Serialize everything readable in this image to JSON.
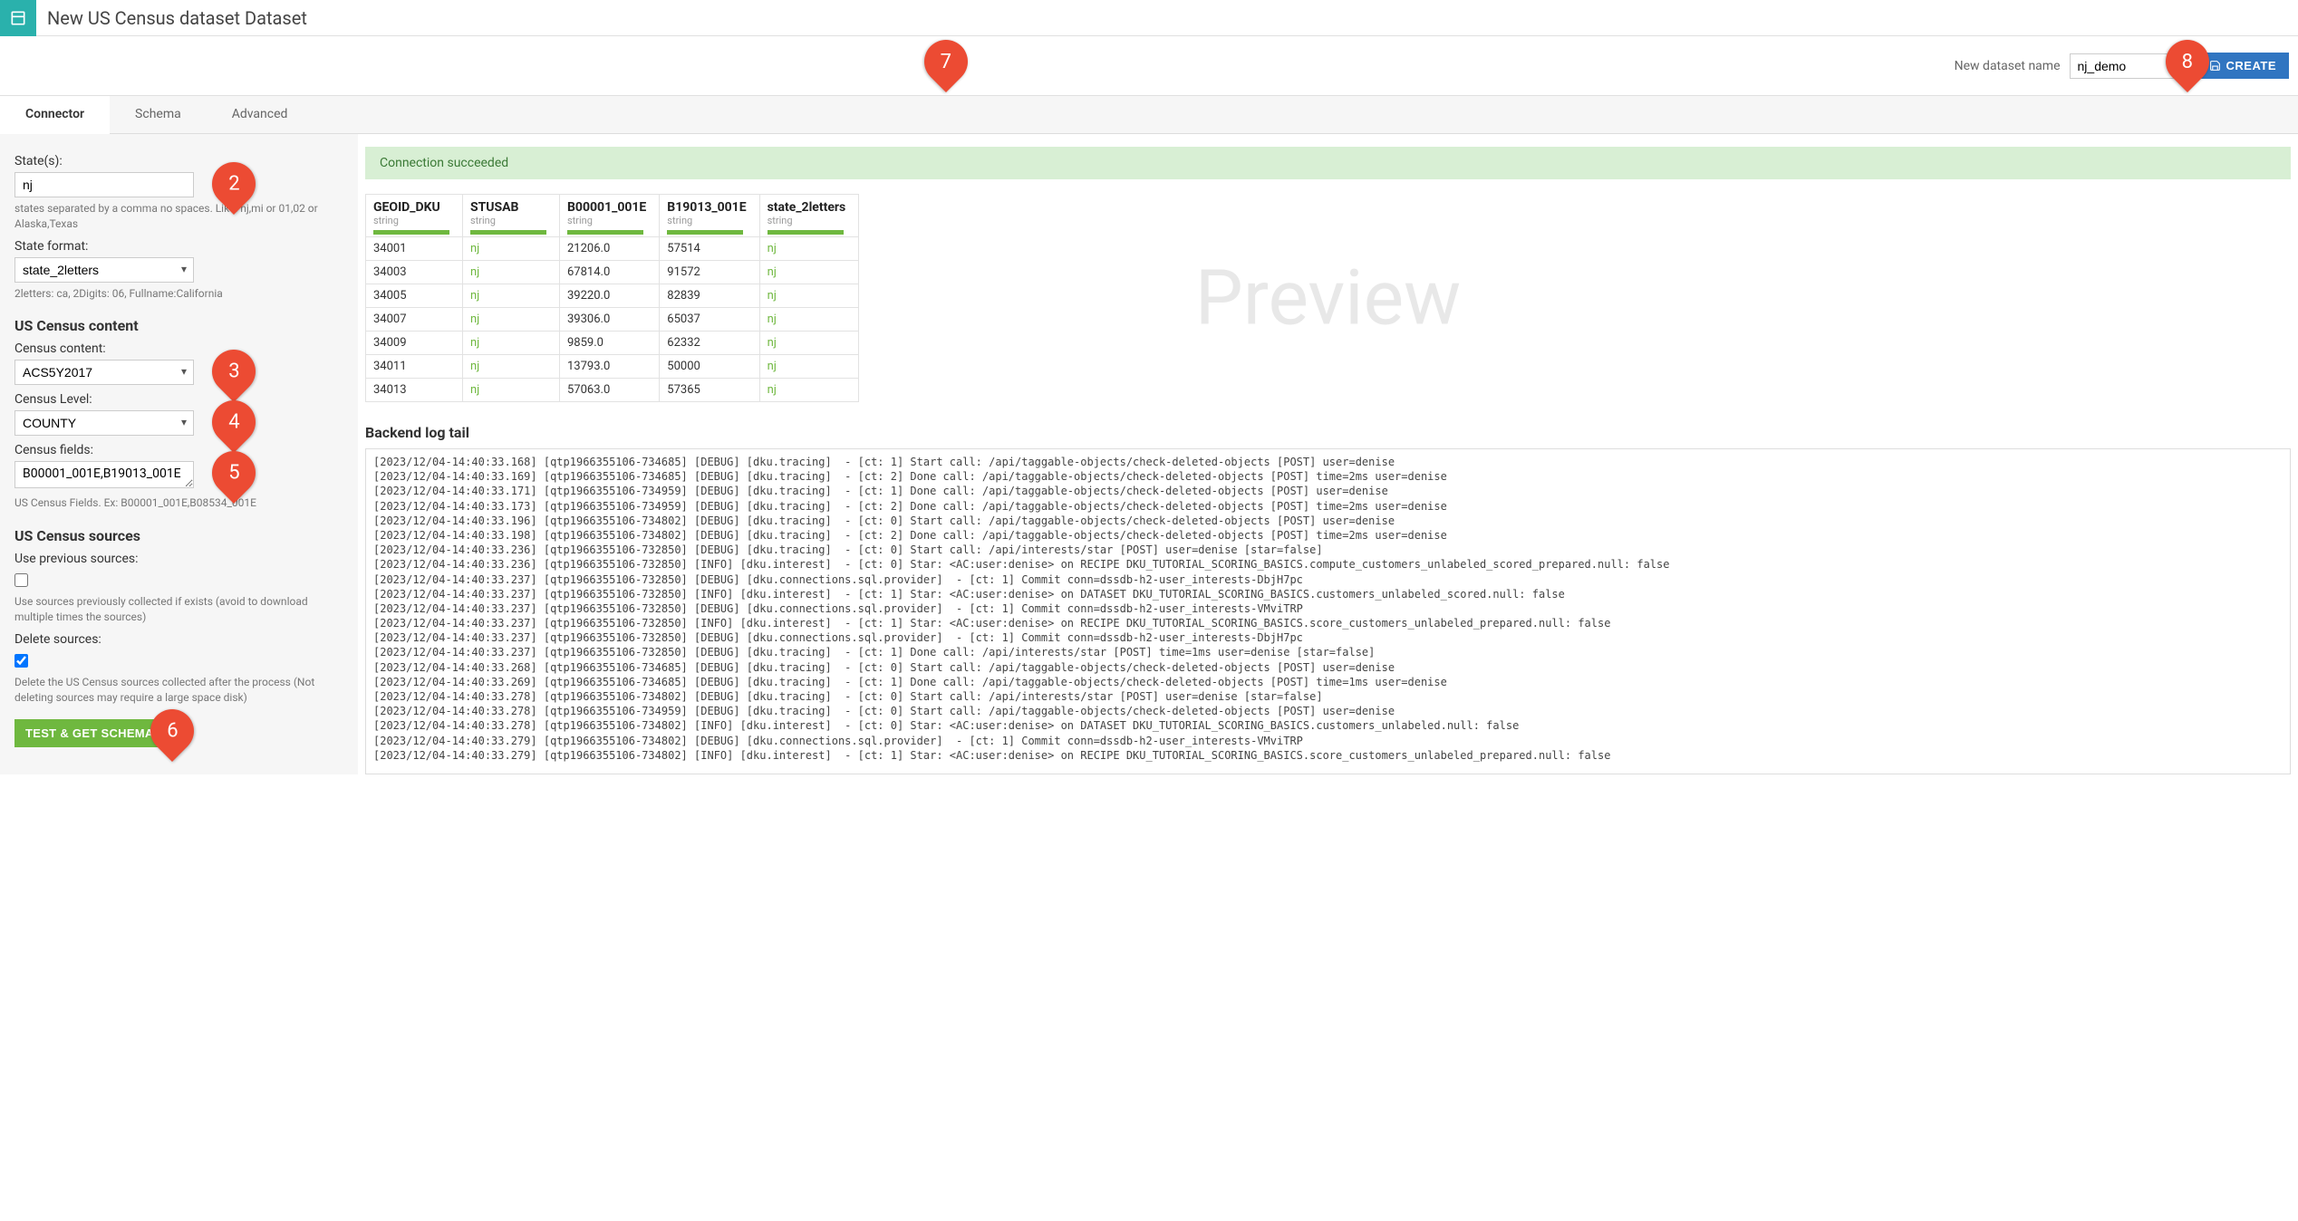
{
  "header": {
    "title": "New US Census dataset Dataset"
  },
  "create": {
    "label": "New dataset name",
    "value": "nj_demo",
    "button": "CREATE"
  },
  "tabs": {
    "connector": "Connector",
    "schema": "Schema",
    "advanced": "Advanced"
  },
  "sidebar": {
    "states_label": "State(s):",
    "states_value": "nj",
    "states_help": "states separated by a comma no spaces. Like: nj,mi or 01,02 or Alaska,Texas",
    "state_format_label": "State format:",
    "state_format_value": "state_2letters",
    "state_format_help": "2letters: ca, 2Digits: 06, Fullname:California",
    "census_content_heading": "US Census content",
    "census_content_label": "Census content:",
    "census_content_value": "ACS5Y2017",
    "census_level_label": "Census Level:",
    "census_level_value": "COUNTY",
    "census_fields_label": "Census fields:",
    "census_fields_value": "B00001_001E,B19013_001E",
    "census_fields_help": "US Census Fields. Ex: B00001_001E,B08534_001E",
    "census_sources_heading": "US Census sources",
    "use_prev_label": "Use previous sources:",
    "use_prev_help": "Use sources previously collected if exists (avoid to download multiple times the sources)",
    "delete_label": "Delete sources:",
    "delete_help": "Delete the US Census sources collected after the process (Not deleting sources may require a large space disk)",
    "test_button": "TEST & GET SCHEMA"
  },
  "content": {
    "success": "Connection succeeded",
    "watermark": "Preview",
    "columns": [
      {
        "name": "GEOID_DKU",
        "type": "string"
      },
      {
        "name": "STUSAB",
        "type": "string"
      },
      {
        "name": "B00001_001E",
        "type": "string"
      },
      {
        "name": "B19013_001E",
        "type": "string"
      },
      {
        "name": "state_2letters",
        "type": "string"
      }
    ],
    "rows": [
      [
        "34001",
        "nj",
        "21206.0",
        "57514",
        "nj"
      ],
      [
        "34003",
        "nj",
        "67814.0",
        "91572",
        "nj"
      ],
      [
        "34005",
        "nj",
        "39220.0",
        "82839",
        "nj"
      ],
      [
        "34007",
        "nj",
        "39306.0",
        "65037",
        "nj"
      ],
      [
        "34009",
        "nj",
        "9859.0",
        "62332",
        "nj"
      ],
      [
        "34011",
        "nj",
        "13793.0",
        "50000",
        "nj"
      ],
      [
        "34013",
        "nj",
        "57063.0",
        "57365",
        "nj"
      ]
    ],
    "log_heading": "Backend log tail",
    "log_lines": [
      "[2023/12/04-14:40:33.168] [qtp1966355106-734685] [DEBUG] [dku.tracing]  - [ct: 1] Start call: /api/taggable-objects/check-deleted-objects [POST] user=denise",
      "[2023/12/04-14:40:33.169] [qtp1966355106-734685] [DEBUG] [dku.tracing]  - [ct: 2] Done call: /api/taggable-objects/check-deleted-objects [POST] time=2ms user=denise",
      "[2023/12/04-14:40:33.171] [qtp1966355106-734959] [DEBUG] [dku.tracing]  - [ct: 1] Done call: /api/taggable-objects/check-deleted-objects [POST] user=denise",
      "[2023/12/04-14:40:33.173] [qtp1966355106-734959] [DEBUG] [dku.tracing]  - [ct: 2] Done call: /api/taggable-objects/check-deleted-objects [POST] time=2ms user=denise",
      "[2023/12/04-14:40:33.196] [qtp1966355106-734802] [DEBUG] [dku.tracing]  - [ct: 0] Start call: /api/taggable-objects/check-deleted-objects [POST] user=denise",
      "[2023/12/04-14:40:33.198] [qtp1966355106-734802] [DEBUG] [dku.tracing]  - [ct: 2] Done call: /api/taggable-objects/check-deleted-objects [POST] time=2ms user=denise",
      "[2023/12/04-14:40:33.236] [qtp1966355106-732850] [DEBUG] [dku.tracing]  - [ct: 0] Start call: /api/interests/star [POST] user=denise [star=false]",
      "[2023/12/04-14:40:33.236] [qtp1966355106-732850] [INFO] [dku.interest]  - [ct: 0] Star: <AC:user:denise> on RECIPE DKU_TUTORIAL_SCORING_BASICS.compute_customers_unlabeled_scored_prepared.null: false",
      "[2023/12/04-14:40:33.237] [qtp1966355106-732850] [DEBUG] [dku.connections.sql.provider]  - [ct: 1] Commit conn=dssdb-h2-user_interests-DbjH7pc",
      "[2023/12/04-14:40:33.237] [qtp1966355106-732850] [INFO] [dku.interest]  - [ct: 1] Star: <AC:user:denise> on DATASET DKU_TUTORIAL_SCORING_BASICS.customers_unlabeled_scored.null: false",
      "[2023/12/04-14:40:33.237] [qtp1966355106-732850] [DEBUG] [dku.connections.sql.provider]  - [ct: 1] Commit conn=dssdb-h2-user_interests-VMviTRP",
      "[2023/12/04-14:40:33.237] [qtp1966355106-732850] [INFO] [dku.interest]  - [ct: 1] Star: <AC:user:denise> on RECIPE DKU_TUTORIAL_SCORING_BASICS.score_customers_unlabeled_prepared.null: false",
      "[2023/12/04-14:40:33.237] [qtp1966355106-732850] [DEBUG] [dku.connections.sql.provider]  - [ct: 1] Commit conn=dssdb-h2-user_interests-DbjH7pc",
      "[2023/12/04-14:40:33.237] [qtp1966355106-732850] [DEBUG] [dku.tracing]  - [ct: 1] Done call: /api/interests/star [POST] time=1ms user=denise [star=false]",
      "[2023/12/04-14:40:33.268] [qtp1966355106-734685] [DEBUG] [dku.tracing]  - [ct: 0] Start call: /api/taggable-objects/check-deleted-objects [POST] user=denise",
      "[2023/12/04-14:40:33.269] [qtp1966355106-734685] [DEBUG] [dku.tracing]  - [ct: 1] Done call: /api/taggable-objects/check-deleted-objects [POST] time=1ms user=denise",
      "[2023/12/04-14:40:33.278] [qtp1966355106-734802] [DEBUG] [dku.tracing]  - [ct: 0] Start call: /api/interests/star [POST] user=denise [star=false]",
      "[2023/12/04-14:40:33.278] [qtp1966355106-734959] [DEBUG] [dku.tracing]  - [ct: 0] Start call: /api/taggable-objects/check-deleted-objects [POST] user=denise",
      "[2023/12/04-14:40:33.278] [qtp1966355106-734802] [INFO] [dku.interest]  - [ct: 0] Star: <AC:user:denise> on DATASET DKU_TUTORIAL_SCORING_BASICS.customers_unlabeled.null: false",
      "[2023/12/04-14:40:33.279] [qtp1966355106-734802] [DEBUG] [dku.connections.sql.provider]  - [ct: 1] Commit conn=dssdb-h2-user_interests-VMviTRP",
      "[2023/12/04-14:40:33.279] [qtp1966355106-734802] [INFO] [dku.interest]  - [ct: 1] Star: <AC:user:denise> on RECIPE DKU_TUTORIAL_SCORING_BASICS.score_customers_unlabeled_prepared.null: false"
    ]
  },
  "callouts": {
    "c2": "2",
    "c3": "3",
    "c4": "4",
    "c5": "5",
    "c6": "6",
    "c7": "7",
    "c8": "8"
  }
}
